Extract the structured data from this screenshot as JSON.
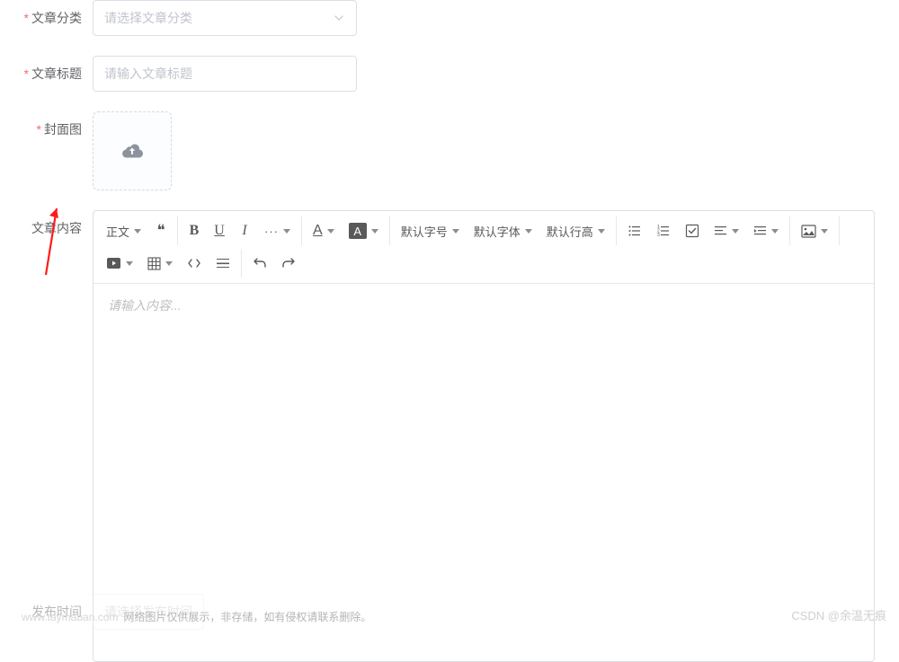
{
  "form": {
    "category": {
      "label": "文章分类",
      "placeholder": "请选择文章分类",
      "required": true
    },
    "title": {
      "label": "文章标题",
      "placeholder": "请输入文章标题",
      "required": true
    },
    "cover": {
      "label": "封面图",
      "required": true
    },
    "content": {
      "label": "文章内容",
      "placeholder": "请输入内容...",
      "required": false
    },
    "publishTime": {
      "label": "发布时间",
      "placeholder": "请选择发布时间"
    }
  },
  "toolbar": {
    "paragraph": "正文",
    "quote": "❝❞",
    "bold": "B",
    "underline": "U",
    "italic": "I",
    "more": "···",
    "fontColor": "A",
    "bgColor": "A",
    "fontSize": "默认字号",
    "fontFamily": "默认字体",
    "lineHeight": "默认行高",
    "ulist": "ul",
    "olist": "ol",
    "task": "task",
    "align": "align",
    "indent": "indent",
    "image": "image",
    "video": "video",
    "table": "table",
    "code": "code",
    "divider": "divider",
    "undo": "undo",
    "redo": "redo"
  },
  "footer": {
    "site": "www.taymaban.com",
    "note": "网络图片仅供展示，非存储，如有侵权请联系删除。",
    "watermark": "CSDN @余温无痕"
  }
}
